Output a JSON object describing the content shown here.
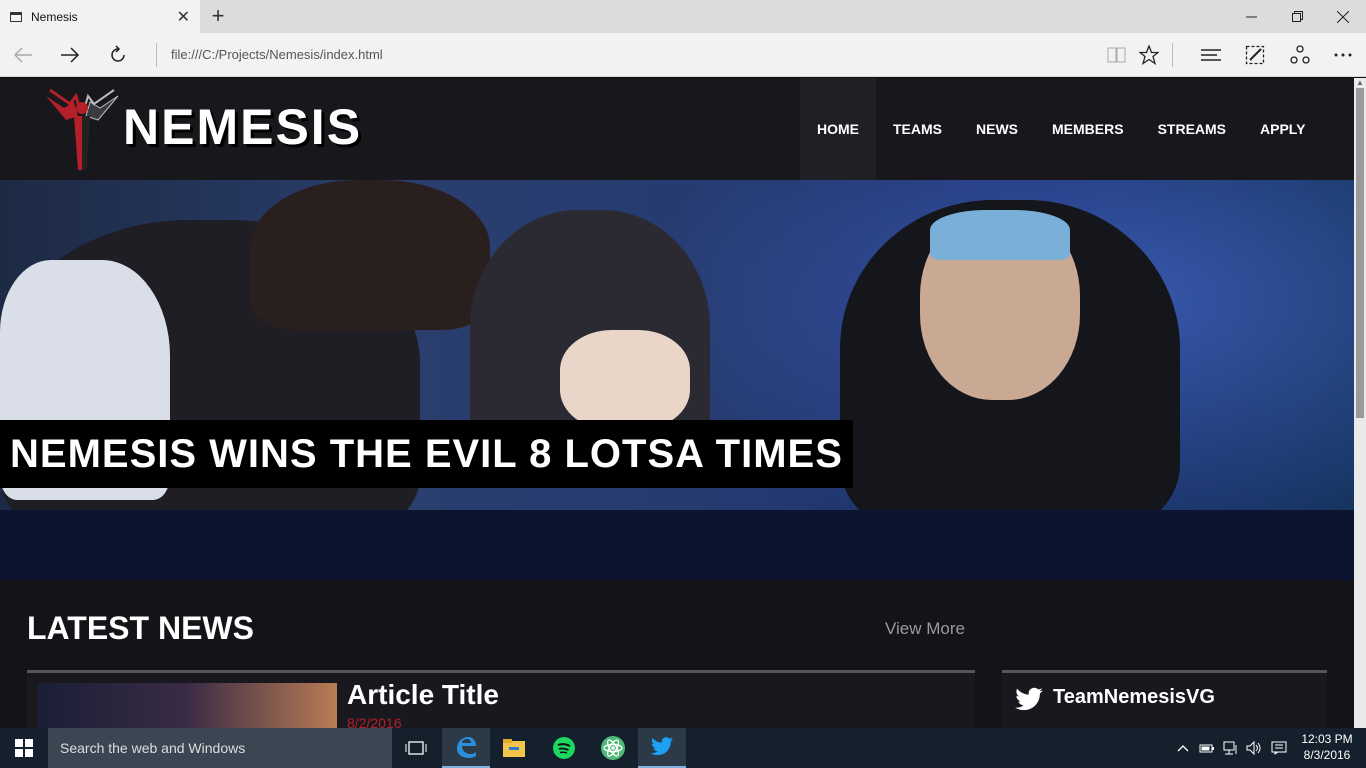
{
  "browser": {
    "tab_title": "Nemesis",
    "url": "file:///C:/Projects/Nemesis/index.html"
  },
  "site": {
    "logo_text": "NEMESIS",
    "nav": [
      "HOME",
      "TEAMS",
      "NEWS",
      "MEMBERS",
      "STREAMS",
      "APPLY"
    ],
    "active_nav": "HOME",
    "hero_headline": "NEMESIS WINS THE EVIL 8 LOTSA TIMES",
    "latest_news_title": "LATEST NEWS",
    "view_more": "View More",
    "article": {
      "title": "Article Title",
      "date": "8/2/2016"
    },
    "twitter_handle": "TeamNemesisVG"
  },
  "taskbar": {
    "search_placeholder": "Search the web and Windows",
    "time": "12:03 PM",
    "date": "8/3/2016"
  },
  "colors": {
    "brand_red": "#b3202a",
    "header_bg": "#17171c",
    "twitter_blue": "#1da1f2"
  }
}
